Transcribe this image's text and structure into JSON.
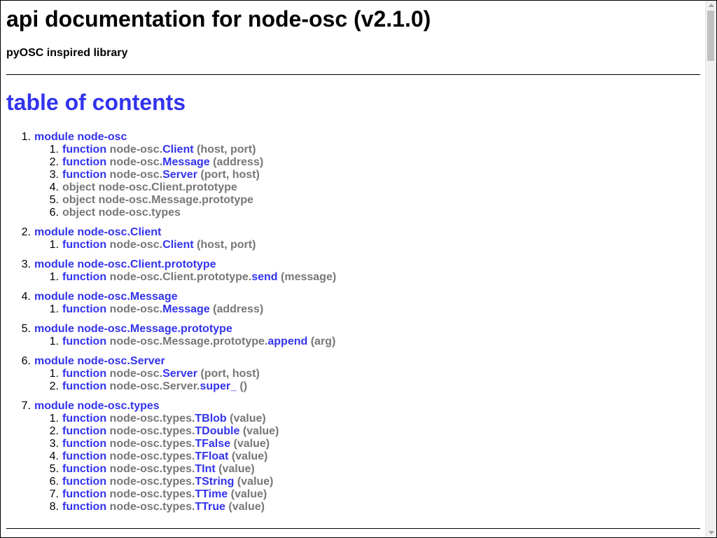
{
  "header": {
    "title": "api documentation for node-osc (v2.1.0)",
    "subtitle": "pyOSC inspired library"
  },
  "toc": {
    "heading": "table of contents",
    "modules": [
      {
        "num": "1.",
        "label": "module node-osc",
        "items": [
          {
            "num": "1.",
            "kind": "function",
            "prefix": "node-osc.",
            "name": "Client",
            "args": "(host, port)"
          },
          {
            "num": "2.",
            "kind": "function",
            "prefix": "node-osc.",
            "name": "Message",
            "args": "(address)"
          },
          {
            "num": "3.",
            "kind": "function",
            "prefix": "node-osc.",
            "name": "Server",
            "args": "(port, host)"
          },
          {
            "num": "4.",
            "kind": "object",
            "prefix": "node-osc.Client.prototype",
            "name": "",
            "args": ""
          },
          {
            "num": "5.",
            "kind": "object",
            "prefix": "node-osc.Message.prototype",
            "name": "",
            "args": ""
          },
          {
            "num": "6.",
            "kind": "object",
            "prefix": "node-osc.types",
            "name": "",
            "args": ""
          }
        ]
      },
      {
        "num": "2.",
        "label": "module node-osc.Client",
        "items": [
          {
            "num": "1.",
            "kind": "function",
            "prefix": "node-osc.",
            "name": "Client",
            "args": "(host, port)"
          }
        ]
      },
      {
        "num": "3.",
        "label": "module node-osc.Client.prototype",
        "items": [
          {
            "num": "1.",
            "kind": "function",
            "prefix": "node-osc.Client.prototype.",
            "name": "send",
            "args": "(message)"
          }
        ]
      },
      {
        "num": "4.",
        "label": "module node-osc.Message",
        "items": [
          {
            "num": "1.",
            "kind": "function",
            "prefix": "node-osc.",
            "name": "Message",
            "args": "(address)"
          }
        ]
      },
      {
        "num": "5.",
        "label": "module node-osc.Message.prototype",
        "items": [
          {
            "num": "1.",
            "kind": "function",
            "prefix": "node-osc.Message.prototype.",
            "name": "append",
            "args": "(arg)"
          }
        ]
      },
      {
        "num": "6.",
        "label": "module node-osc.Server",
        "items": [
          {
            "num": "1.",
            "kind": "function",
            "prefix": "node-osc.",
            "name": "Server",
            "args": "(port, host)"
          },
          {
            "num": "2.",
            "kind": "function",
            "prefix": "node-osc.Server.",
            "name": "super_",
            "args": "()"
          }
        ]
      },
      {
        "num": "7.",
        "label": "module node-osc.types",
        "items": [
          {
            "num": "1.",
            "kind": "function",
            "prefix": "node-osc.types.",
            "name": "TBlob",
            "args": "(value)"
          },
          {
            "num": "2.",
            "kind": "function",
            "prefix": "node-osc.types.",
            "name": "TDouble",
            "args": "(value)"
          },
          {
            "num": "3.",
            "kind": "function",
            "prefix": "node-osc.types.",
            "name": "TFalse",
            "args": "(value)"
          },
          {
            "num": "4.",
            "kind": "function",
            "prefix": "node-osc.types.",
            "name": "TFloat",
            "args": "(value)"
          },
          {
            "num": "5.",
            "kind": "function",
            "prefix": "node-osc.types.",
            "name": "TInt",
            "args": "(value)"
          },
          {
            "num": "6.",
            "kind": "function",
            "prefix": "node-osc.types.",
            "name": "TString",
            "args": "(value)"
          },
          {
            "num": "7.",
            "kind": "function",
            "prefix": "node-osc.types.",
            "name": "TTime",
            "args": "(value)"
          },
          {
            "num": "8.",
            "kind": "function",
            "prefix": "node-osc.types.",
            "name": "TTrue",
            "args": "(value)"
          }
        ]
      }
    ]
  },
  "colors": {
    "link": "#3333ee",
    "muted": "#777777"
  }
}
